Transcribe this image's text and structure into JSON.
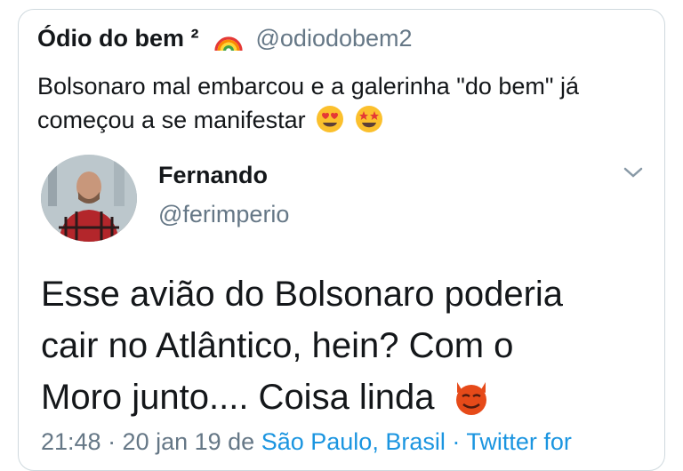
{
  "outer_tweet": {
    "name": "Ódio do bem ²",
    "handle": "@odiodobem2",
    "text_line1": "Bolsonaro mal embarcou e a galerinha \"do bem\" já",
    "text_line2": "começou a se manifestar",
    "icons": [
      "rainbow-emoji",
      "heart-eyes-emoji",
      "star-struck-emoji"
    ]
  },
  "quoted_tweet": {
    "name": "Fernando",
    "handle": "@ferimperio",
    "text_line1": "Esse avião do Bolsonaro poderia",
    "text_line2": "cair no Atlântico, hein? Com o",
    "text_line3": "Moro junto.... Coisa linda",
    "icons": [
      "chevron-down-icon",
      "smiling-devil-emoji"
    ],
    "meta": {
      "time": "21:48 · 20 jan 19 de",
      "location": "São Paulo, Brasil",
      "source": " · Twitter for"
    }
  },
  "colors": {
    "text": "#14171a",
    "secondary": "#657786",
    "link": "#1b95e0",
    "border": "#cfd9de"
  }
}
